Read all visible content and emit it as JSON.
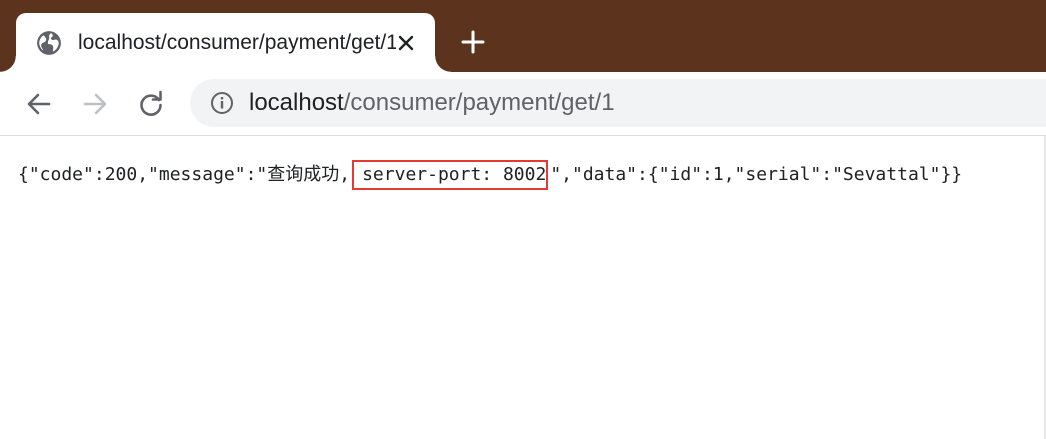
{
  "browser": {
    "tab": {
      "title": "localhost/consumer/payment/get/1",
      "favicon": "globe-icon",
      "close_icon": "close-icon"
    },
    "new_tab_icon": "plus-icon",
    "toolbar": {
      "back_icon": "arrow-left-icon",
      "forward_icon": "arrow-right-icon",
      "reload_icon": "reload-icon",
      "info_icon": "info-circle-icon"
    },
    "address": {
      "host": "localhost",
      "path": "/consumer/payment/get/1"
    },
    "colors": {
      "tabbar": "#5c341e",
      "omnibox": "#f1f3f4",
      "highlight": "#e53935"
    }
  },
  "page": {
    "json_prefix": "{\"code\":200,\"message\":\"查询成功,",
    "json_highlight": "server-port: 8002",
    "json_suffix": "\",\"data\":{\"id\":1,\"serial\":\"Sevattal\"}}"
  }
}
